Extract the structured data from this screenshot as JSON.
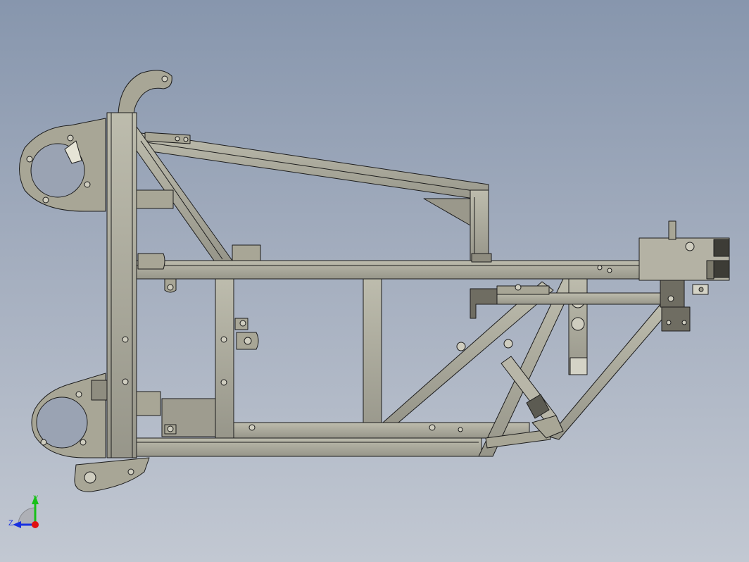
{
  "viewport": {
    "background_top": "#8796ad",
    "background_bottom": "#c2c8d2"
  },
  "model": {
    "part_fill": "#a8a696",
    "part_dark": "#7c7a6c",
    "edge_color": "#1c1c1c",
    "hole_fill": "#cfcdbf"
  },
  "triad": {
    "x_label": "",
    "y_label": "Y",
    "z_label": "Z",
    "x_color": "#e01010",
    "y_color": "#18c018",
    "z_color": "#1830e0"
  }
}
